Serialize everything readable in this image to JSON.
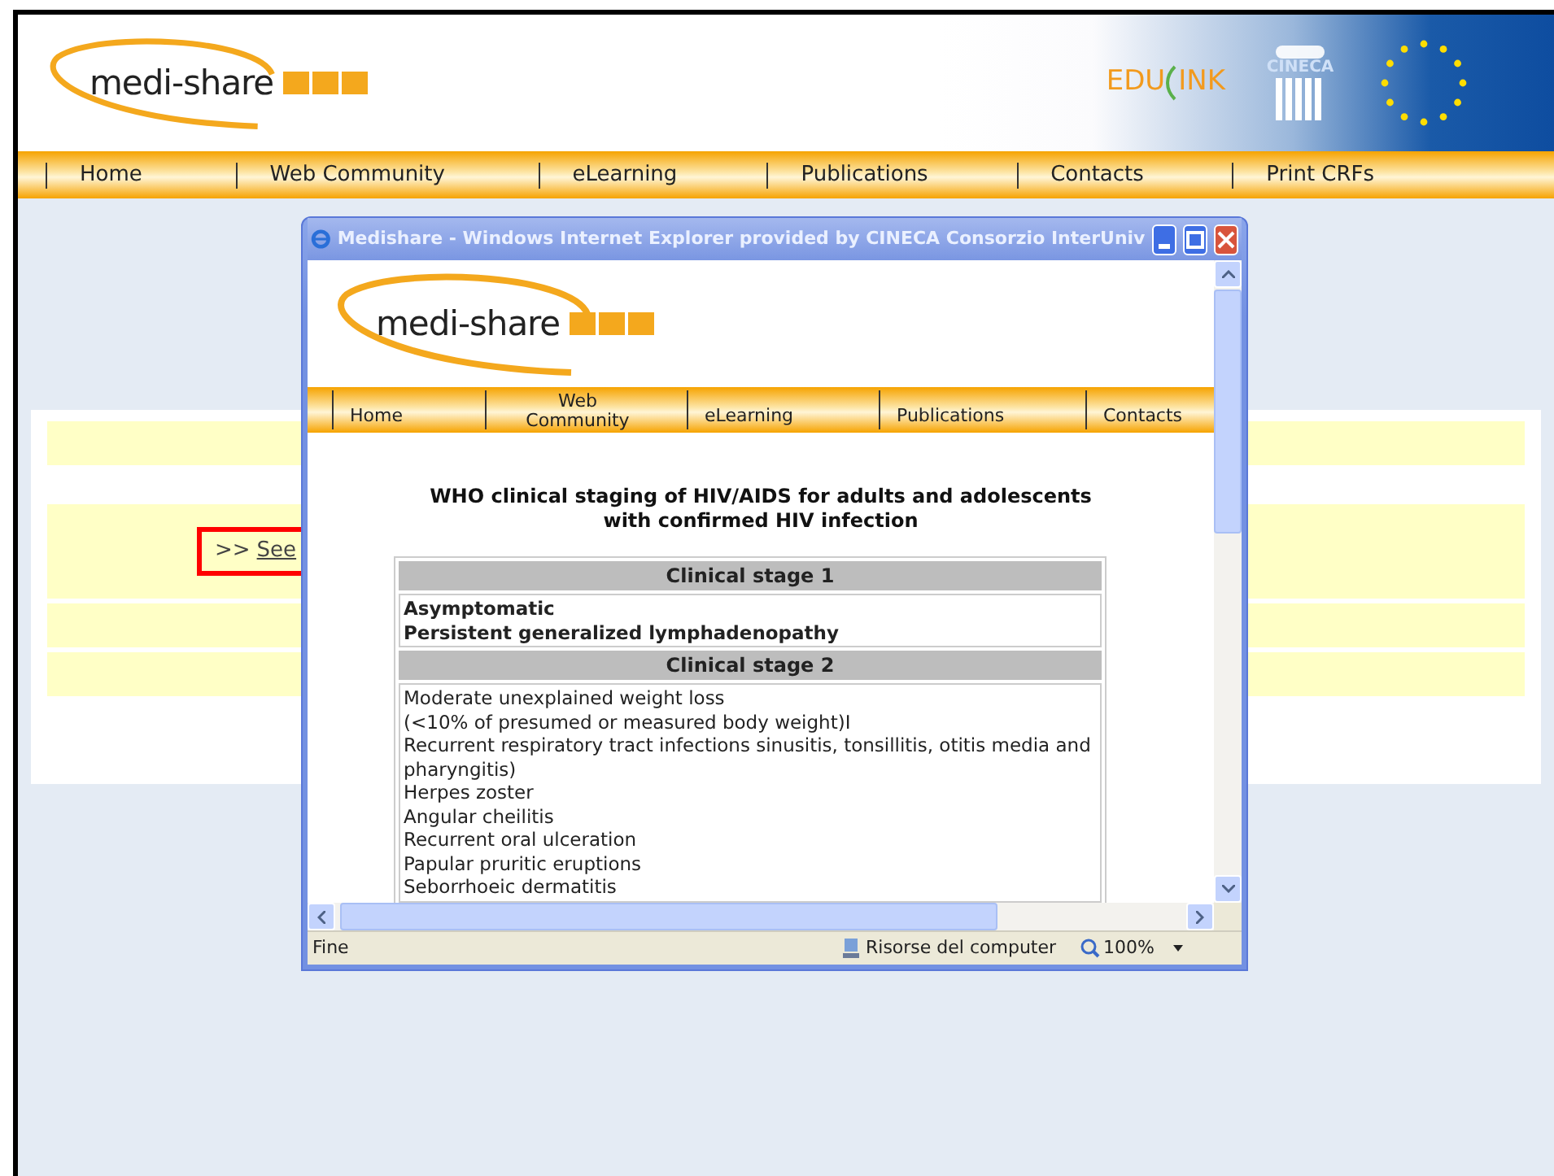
{
  "header": {
    "logo_text": "medi-share",
    "partner_logo_parts": [
      "EDU",
      "INK"
    ],
    "institute_logo_text": "CINECA"
  },
  "nav": [
    "Home",
    "Web Community",
    "eLearning",
    "Publications",
    "Contacts",
    "Print CRFs"
  ],
  "content": {
    "link_prefix": ">>",
    "link_text": "See"
  },
  "popup": {
    "title": "Medishare - Windows Internet Explorer provided by CINECA Consorzio InterUniv",
    "logo_text": "medi-share",
    "nav": [
      "Home",
      "Web Community",
      "eLearning",
      "Publications",
      "Contacts"
    ],
    "heading": "WHO clinical staging of HIV/AIDS for adults and adolescents with confirmed HIV infection",
    "stages": [
      {
        "heading": "Clinical stage 1",
        "emphasis": true,
        "items": [
          "Asymptomatic",
          "Persistent generalized lymphadenopathy"
        ]
      },
      {
        "heading": "Clinical stage 2",
        "emphasis": false,
        "items": [
          "Moderate unexplained weight loss",
          "(<10% of presumed or measured body weight)I",
          "Recurrent respiratory tract infections sinusitis, tonsillitis, otitis media and pharyngitis)",
          "Herpes zoster",
          "Angular cheilitis",
          "Recurrent oral ulceration",
          "Papular pruritic eruptions",
          "Seborrhoeic dermatitis"
        ]
      }
    ],
    "status": {
      "text": "Fine",
      "zone": "Risorse del computer",
      "zoom": "100%"
    }
  }
}
